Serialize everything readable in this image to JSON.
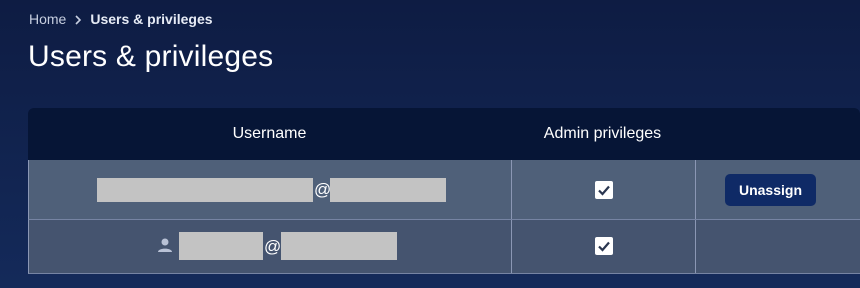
{
  "breadcrumb": {
    "home": "Home",
    "current": "Users & privileges"
  },
  "page": {
    "title": "Users & privileges"
  },
  "table": {
    "columns": {
      "username": "Username",
      "admin": "Admin privileges"
    },
    "rows": [
      {
        "at_sign": "@",
        "admin_checked": true,
        "action_label": "Unassign",
        "has_user_icon": false
      },
      {
        "at_sign": "@",
        "admin_checked": true,
        "action_label": "",
        "has_user_icon": true
      }
    ]
  },
  "colors": {
    "background": "#0e1c43",
    "header": "#061536",
    "row1": "#4f6079",
    "row2": "#45546f",
    "button": "#0f2a66"
  },
  "icons": {
    "breadcrumb_separator": "chevron-right-icon",
    "user": "person-icon",
    "checkbox": "checkbox-checked-icon"
  }
}
